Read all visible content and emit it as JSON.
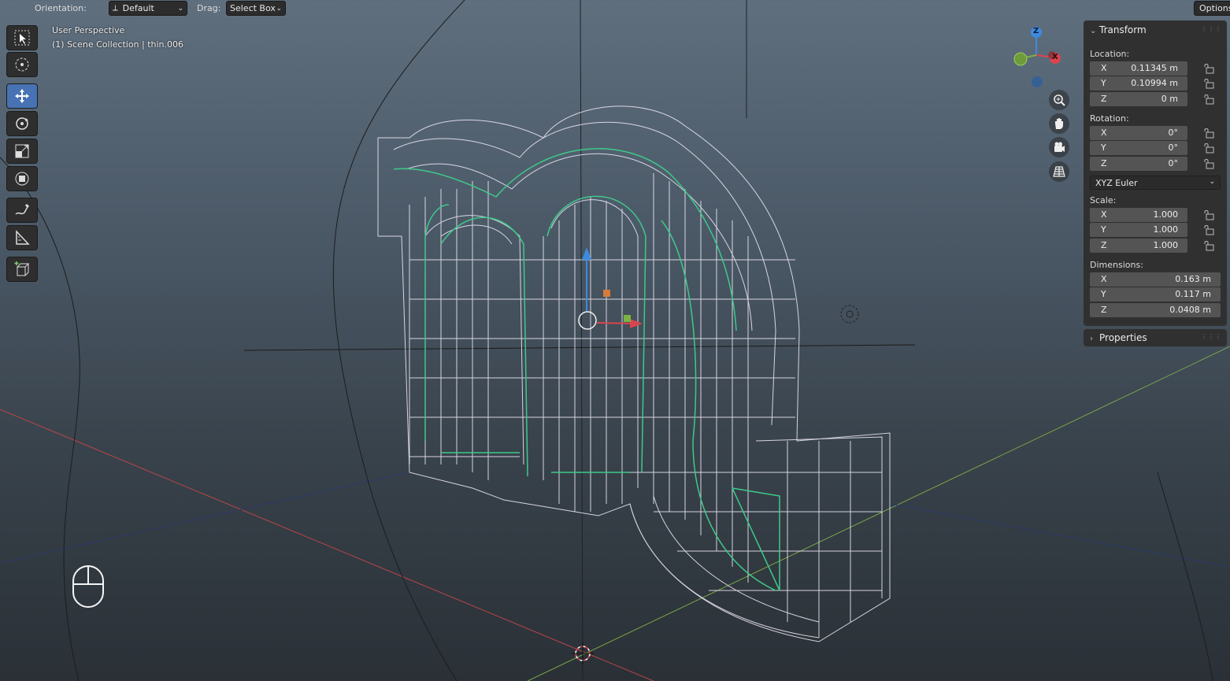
{
  "header": {
    "orientation_label": "Orientation:",
    "orientation_value": "Default",
    "drag_label": "Drag:",
    "drag_value": "Select Box",
    "options_label": "Options"
  },
  "viewport": {
    "view_name": "User Perspective",
    "collection_info": "(1) Scene Collection | thin.006"
  },
  "toolbar": {
    "tools": [
      "select-box",
      "cursor",
      "move",
      "rotate",
      "scale",
      "transform",
      "annotate",
      "measure",
      "add-cube"
    ],
    "active_tool": "move"
  },
  "gizmo": {
    "z_label": "Z",
    "x_label": "X"
  },
  "transform": {
    "title": "Transform",
    "location_label": "Location:",
    "location": [
      {
        "axis": "X",
        "value": "0.11345 m"
      },
      {
        "axis": "Y",
        "value": "0.10994 m"
      },
      {
        "axis": "Z",
        "value": "0 m"
      }
    ],
    "rotation_label": "Rotation:",
    "rotation": [
      {
        "axis": "X",
        "value": "0°"
      },
      {
        "axis": "Y",
        "value": "0°"
      },
      {
        "axis": "Z",
        "value": "0°"
      }
    ],
    "rotation_mode": "XYZ Euler",
    "scale_label": "Scale:",
    "scale": [
      {
        "axis": "X",
        "value": "1.000"
      },
      {
        "axis": "Y",
        "value": "1.000"
      },
      {
        "axis": "Z",
        "value": "1.000"
      }
    ],
    "dimensions_label": "Dimensions:",
    "dimensions": [
      {
        "axis": "X",
        "value": "0.163 m"
      },
      {
        "axis": "Y",
        "value": "0.117 m"
      },
      {
        "axis": "Z",
        "value": "0.0408 m"
      }
    ]
  },
  "properties": {
    "title": "Properties"
  },
  "colors": {
    "active_tool": "#4772b3",
    "x_axis": "#d9454f",
    "y_axis": "#7cb342",
    "z_axis": "#3d8be0",
    "wire": "#e8e4f0",
    "selected_wire": "#3ec98a"
  }
}
